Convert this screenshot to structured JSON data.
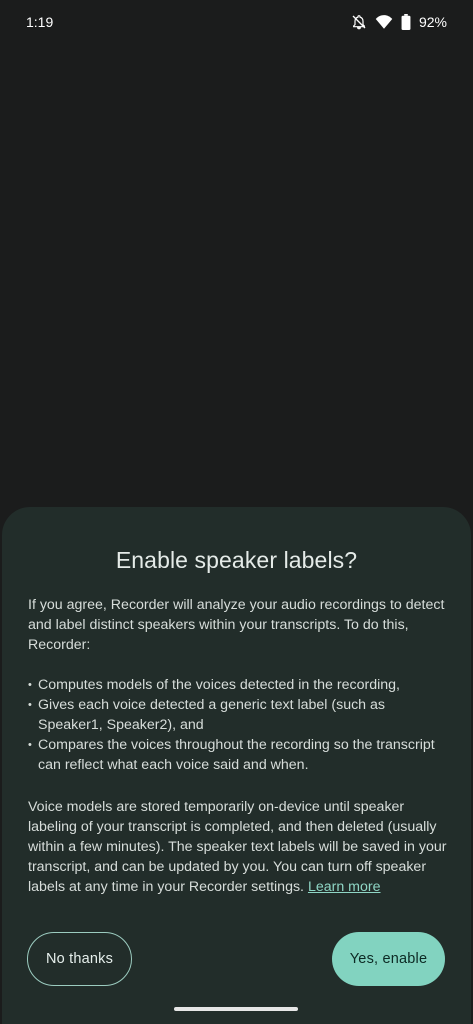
{
  "status_bar": {
    "time": "1:19",
    "battery": "92%",
    "icons": [
      "bell-off-icon",
      "wifi-icon",
      "battery-icon"
    ]
  },
  "dialog": {
    "title": "Enable speaker labels?",
    "intro": "If you agree, Recorder will analyze your audio recordings to detect and label distinct speakers within your transcripts. To do this, Recorder:",
    "bullets": [
      "Computes models of the voices detected in the recording,",
      "Gives each voice detected a generic text label (such as Speaker1, Speaker2), and",
      "Compares the voices throughout the recording so the transcript can reflect what each voice said and when."
    ],
    "details": "Voice models are stored temporarily on-device until speaker labeling of your transcript is completed, and then deleted (usually within a few minutes). The speaker text labels will be saved in your transcript, and can be updated by you. You can turn off speaker labels at any time in your Recorder settings.",
    "learn_more": "Learn more",
    "no_button": "No thanks",
    "yes_button": "Yes, enable"
  },
  "colors": {
    "background": "#1b1c1c",
    "sheet": "#222d2a",
    "accent": "#82d3c0",
    "link": "#8fd6c5"
  }
}
